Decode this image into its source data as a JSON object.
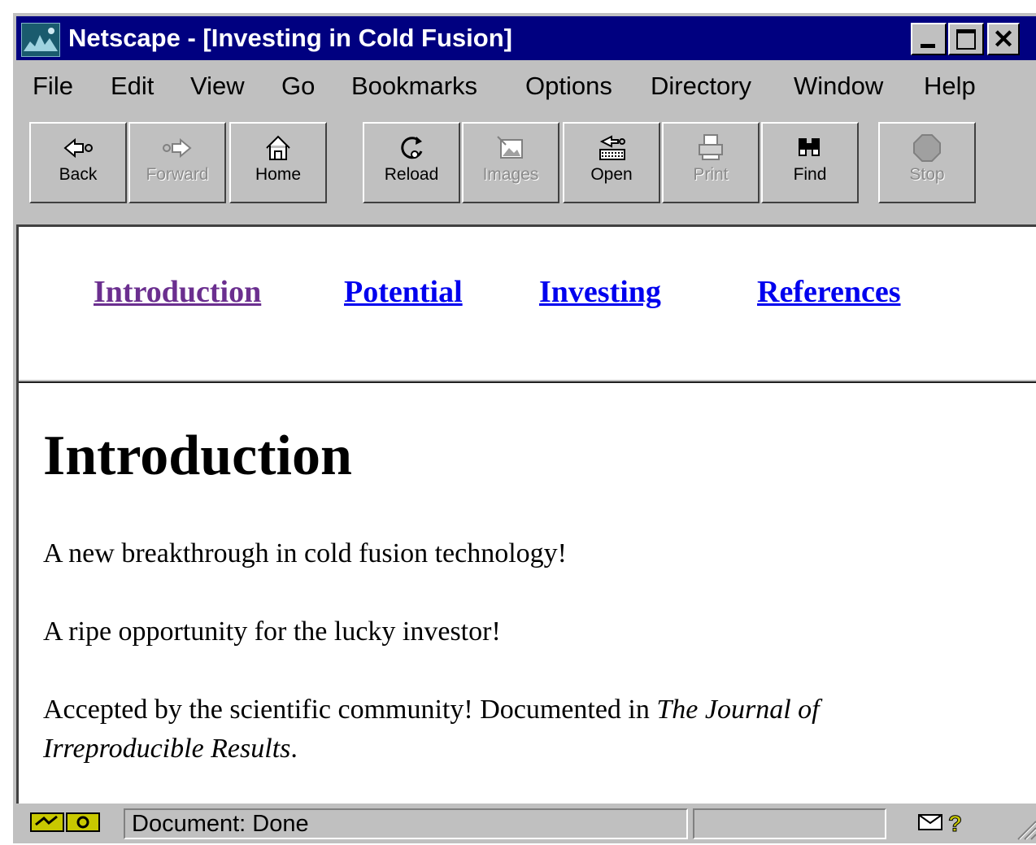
{
  "window": {
    "title": "Netscape - [Investing in Cold Fusion]",
    "close_glyph": "✕"
  },
  "menu": [
    "File",
    "Edit",
    "View",
    "Go",
    "Bookmarks",
    "Options",
    "Directory",
    "Window",
    "Help"
  ],
  "toolbar": {
    "back": "Back",
    "forward": "Forward",
    "home": "Home",
    "reload": "Reload",
    "images": "Images",
    "open": "Open",
    "print": "Print",
    "find": "Find",
    "stop": "Stop"
  },
  "nav_links": {
    "introduction": "Introduction",
    "potential": "Potential",
    "investing": "Investing",
    "references": "References",
    "visited_color": "#6b2f8f",
    "link_color": "#0000ee"
  },
  "content": {
    "heading": "Introduction",
    "para1": "A new breakthrough in cold fusion technology!",
    "para2": "A ripe opportunity for the lucky investor!",
    "para3_text": "Accepted by the scientific community! Documented in ",
    "para3_italic": "The Journal of Irreproducible Results",
    "para3_end": "."
  },
  "status": {
    "text": "Document: Done"
  },
  "colors": {
    "titlebar": "#000080",
    "chrome": "#c0c0c0"
  }
}
